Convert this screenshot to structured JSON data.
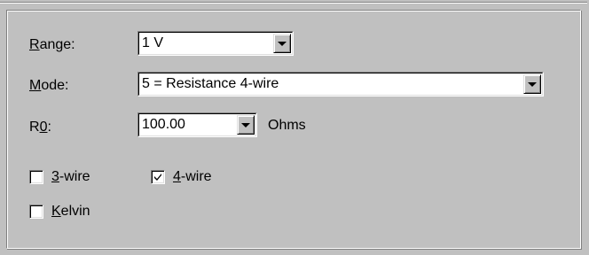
{
  "range": {
    "label_accel": "R",
    "label_rest": "ange:",
    "value": "1 V"
  },
  "mode": {
    "label_accel": "M",
    "label_rest": "ode:",
    "value": "5 = Resistance 4-wire"
  },
  "r0": {
    "label_pre": "R",
    "label_accel": "0",
    "label_post": ":",
    "value": "100.00",
    "unit": "Ohms"
  },
  "checkboxes": {
    "three_wire": {
      "accel": "3",
      "rest": "-wire",
      "checked": false
    },
    "four_wire": {
      "accel": "4",
      "rest": "-wire",
      "checked": true
    },
    "kelvin": {
      "accel": "K",
      "rest": "elvin",
      "checked": false
    }
  },
  "icons": {
    "dropdown": "chevron-down-icon",
    "check": "checkmark-icon"
  },
  "colors": {
    "face": "#c0c0c0",
    "shadow": "#808080",
    "highlight": "#ffffff",
    "field": "#ffffff"
  }
}
